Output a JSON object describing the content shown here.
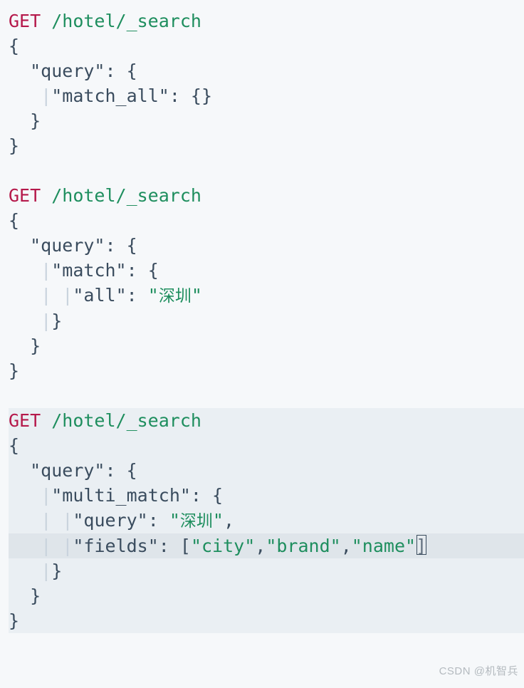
{
  "blocks": [
    {
      "method": "GET",
      "path": "/hotel/_search",
      "lines": [
        {
          "indent": 0,
          "parts": [
            {
              "t": "punc",
              "v": "{"
            }
          ]
        },
        {
          "indent": 2,
          "parts": [
            {
              "t": "key",
              "v": "\"query\""
            },
            {
              "t": "punc",
              "v": ": {"
            }
          ]
        },
        {
          "indent": 4,
          "guide": 3,
          "parts": [
            {
              "t": "key",
              "v": "\"match_all\""
            },
            {
              "t": "punc",
              "v": ": {}"
            }
          ]
        },
        {
          "indent": 2,
          "parts": [
            {
              "t": "punc",
              "v": "}"
            }
          ]
        },
        {
          "indent": 0,
          "parts": [
            {
              "t": "punc",
              "v": "}"
            }
          ]
        }
      ]
    },
    {
      "method": "GET",
      "path": "/hotel/_search",
      "lines": [
        {
          "indent": 0,
          "parts": [
            {
              "t": "punc",
              "v": "{"
            }
          ]
        },
        {
          "indent": 2,
          "parts": [
            {
              "t": "key",
              "v": "\"query\""
            },
            {
              "t": "punc",
              "v": ": {"
            }
          ]
        },
        {
          "indent": 4,
          "guide": 3,
          "parts": [
            {
              "t": "key",
              "v": "\"match\""
            },
            {
              "t": "punc",
              "v": ": {"
            }
          ]
        },
        {
          "indent": 6,
          "guide": 5,
          "guide2": 3,
          "parts": [
            {
              "t": "key",
              "v": "\"all\""
            },
            {
              "t": "punc",
              "v": ": "
            },
            {
              "t": "str",
              "v": "\"深圳\""
            }
          ]
        },
        {
          "indent": 4,
          "guide": 3,
          "parts": [
            {
              "t": "punc",
              "v": "}"
            }
          ]
        },
        {
          "indent": 2,
          "parts": [
            {
              "t": "punc",
              "v": "}"
            }
          ]
        },
        {
          "indent": 0,
          "parts": [
            {
              "t": "punc",
              "v": "}"
            }
          ]
        }
      ]
    },
    {
      "method": "GET",
      "path": "/hotel/_search",
      "highlight": true,
      "lines": [
        {
          "indent": 0,
          "parts": [
            {
              "t": "punc",
              "v": "{"
            }
          ]
        },
        {
          "indent": 2,
          "parts": [
            {
              "t": "key",
              "v": "\"query\""
            },
            {
              "t": "punc",
              "v": ": {"
            }
          ]
        },
        {
          "indent": 4,
          "guide": 3,
          "parts": [
            {
              "t": "key",
              "v": "\"multi_match\""
            },
            {
              "t": "punc",
              "v": ": {"
            }
          ]
        },
        {
          "indent": 6,
          "guide": 5,
          "guide2": 3,
          "parts": [
            {
              "t": "key",
              "v": "\"query\""
            },
            {
              "t": "punc",
              "v": ": "
            },
            {
              "t": "str",
              "v": "\"深圳\""
            },
            {
              "t": "punc",
              "v": ","
            }
          ]
        },
        {
          "indent": 6,
          "guide": 5,
          "guide2": 3,
          "cursor": true,
          "parts": [
            {
              "t": "key",
              "v": "\"fields\""
            },
            {
              "t": "punc",
              "v": ": ["
            },
            {
              "t": "field",
              "v": "\"city\""
            },
            {
              "t": "punc",
              "v": ","
            },
            {
              "t": "field",
              "v": "\"brand\""
            },
            {
              "t": "punc",
              "v": ","
            },
            {
              "t": "field",
              "v": "\"name\""
            },
            {
              "t": "punc",
              "v": "]"
            }
          ],
          "caret": true
        },
        {
          "indent": 4,
          "guide": 3,
          "parts": [
            {
              "t": "punc",
              "v": "}"
            }
          ]
        },
        {
          "indent": 2,
          "parts": [
            {
              "t": "punc",
              "v": "}"
            }
          ]
        },
        {
          "indent": 0,
          "parts": [
            {
              "t": "punc",
              "v": "}"
            }
          ]
        }
      ]
    }
  ],
  "watermark": "CSDN @机智兵"
}
